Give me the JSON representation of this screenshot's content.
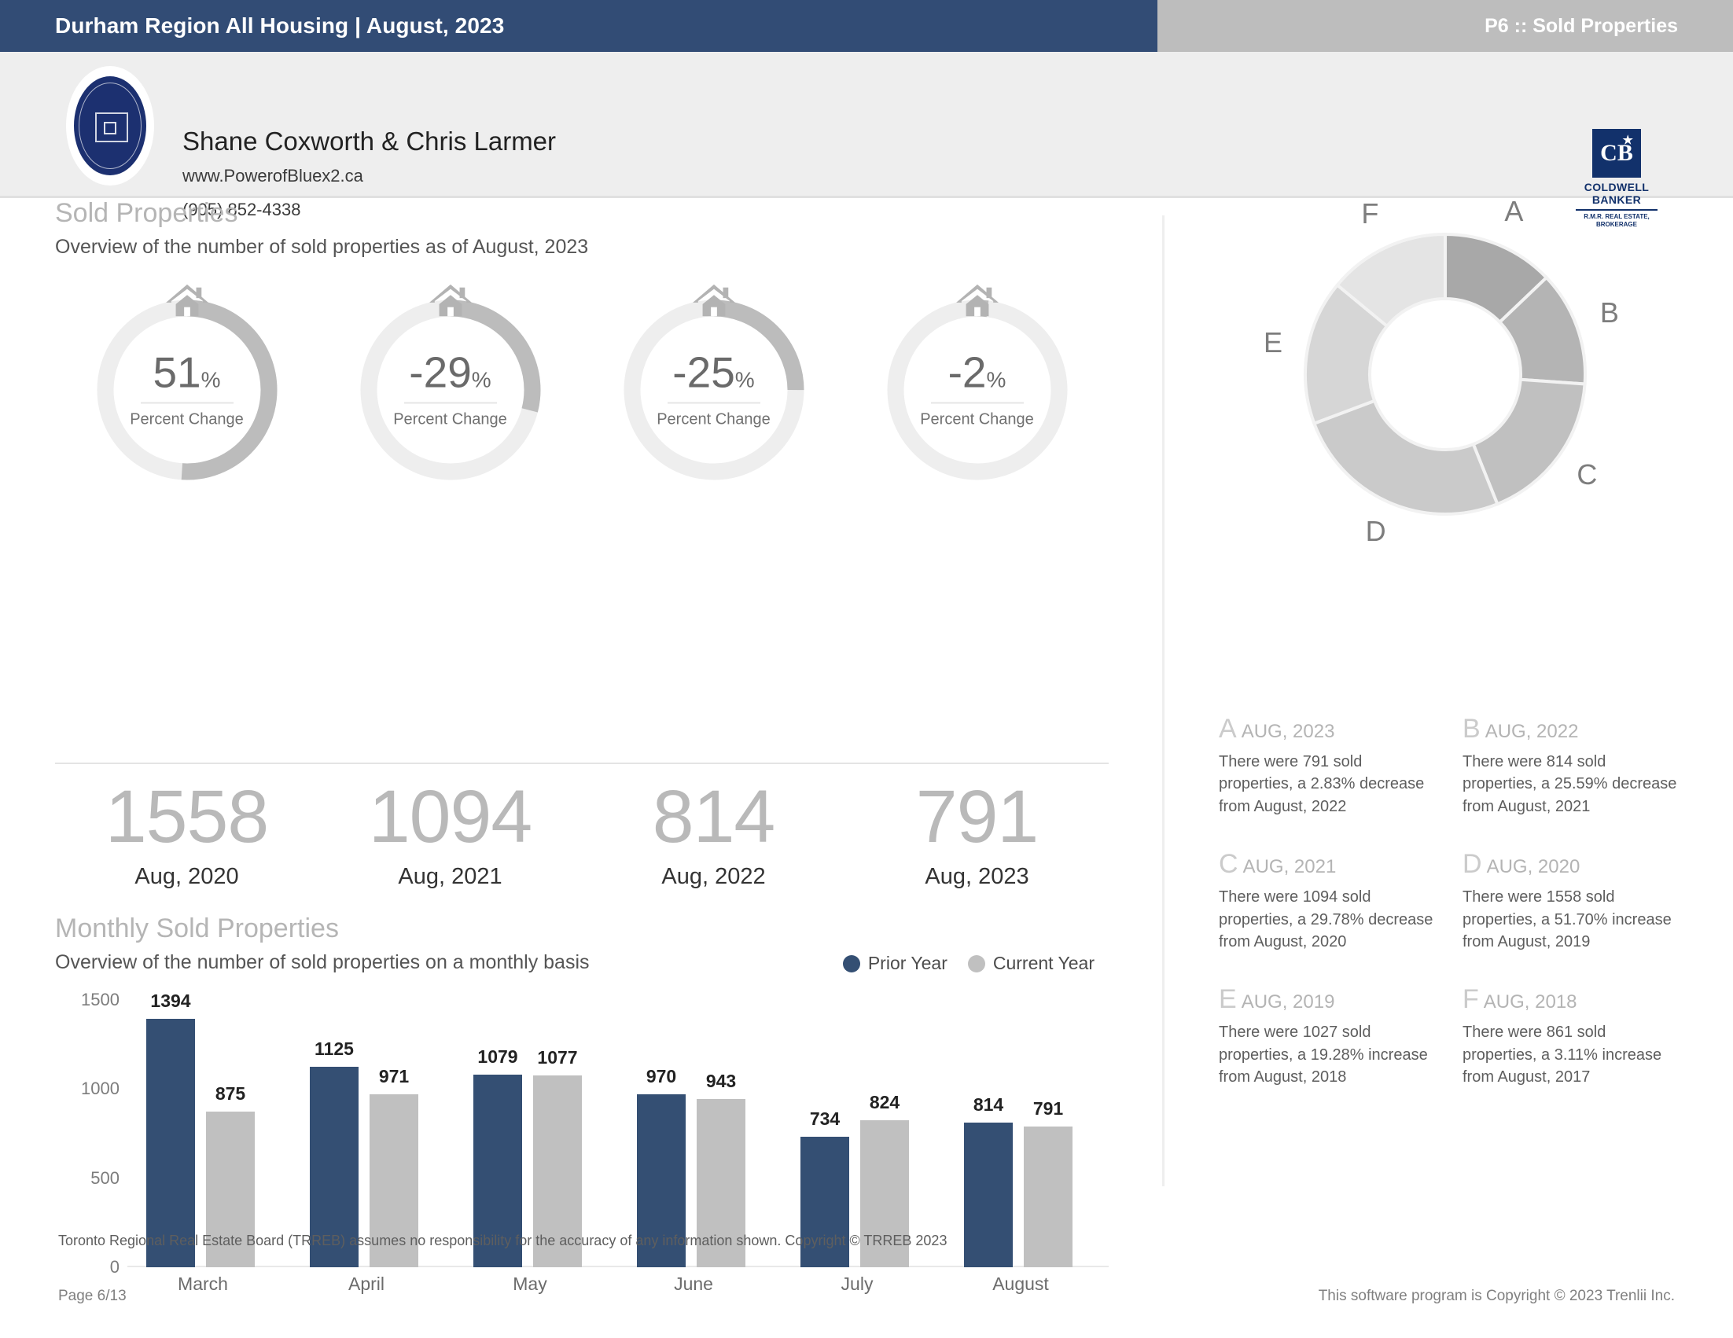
{
  "header": {
    "title": "Durham Region All Housing | August, 2023",
    "page_tag": "P6 :: Sold Properties"
  },
  "agent": {
    "name": "Shane Coxworth & Chris Larmer",
    "website": "www.PowerofBluex2.ca",
    "phone": "(905) 852-4338",
    "brokerage_name_line1": "COLDWELL",
    "brokerage_name_line2": "BANKER",
    "brokerage_sub_line1": "R.M.R. REAL ESTATE,",
    "brokerage_sub_line2": "BROKERAGE",
    "brokerage_mark": "CB"
  },
  "sold_section": {
    "title": "Sold Properties",
    "subtitle": "Overview of the number of sold properties as of August, 2023",
    "gauge_label": "Percent Change",
    "gauges": [
      {
        "percent_text": "51",
        "unit": "%",
        "fill": 51,
        "value": "1558",
        "year": "Aug, 2020"
      },
      {
        "percent_text": "-29",
        "unit": "%",
        "fill": 29,
        "value": "1094",
        "year": "Aug, 2021"
      },
      {
        "percent_text": "-25",
        "unit": "%",
        "fill": 25,
        "value": "814",
        "year": "Aug, 2022"
      },
      {
        "percent_text": "-2",
        "unit": "%",
        "fill": 2,
        "value": "791",
        "year": "Aug, 2023"
      }
    ]
  },
  "monthly_section": {
    "title": "Monthly Sold Properties",
    "subtitle": "Overview of the number of sold properties on a monthly basis",
    "legend": [
      {
        "label": "Prior Year",
        "color": "#344f73"
      },
      {
        "label": "Current Year",
        "color": "#c0c0c0"
      }
    ]
  },
  "chart_data": [
    {
      "type": "bar",
      "title": "Monthly Sold Properties",
      "xlabel": "",
      "ylabel": "",
      "ylim": [
        0,
        1500
      ],
      "yticks": [
        "0",
        "500",
        "1000",
        "1500"
      ],
      "grid": false,
      "legend_position": "top-right",
      "categories": [
        "March",
        "April",
        "May",
        "June",
        "July",
        "August"
      ],
      "series": [
        {
          "name": "Prior Year",
          "color": "#344f73",
          "values": [
            1394,
            1125,
            1079,
            970,
            734,
            814
          ]
        },
        {
          "name": "Current Year",
          "color": "#c0c0c0",
          "values": [
            875,
            971,
            1077,
            943,
            824,
            791
          ]
        }
      ]
    },
    {
      "type": "pie",
      "title": "",
      "labels": [
        "A",
        "B",
        "C",
        "D",
        "E",
        "F"
      ],
      "categories": [
        "AUG, 2023",
        "AUG, 2022",
        "AUG, 2021",
        "AUG, 2020",
        "AUG, 2019",
        "AUG, 2018"
      ],
      "values": [
        791,
        814,
        1094,
        1558,
        1027,
        861
      ],
      "colors": [
        "#a8a8a8",
        "#b4b4b4",
        "#c0c0c0",
        "#cacaca",
        "#d6d6d6",
        "#e4e4e4"
      ],
      "donut": true
    }
  ],
  "donut_labels": [
    {
      "letter": "A"
    },
    {
      "letter": "B"
    },
    {
      "letter": "C"
    },
    {
      "letter": "D"
    },
    {
      "letter": "E"
    },
    {
      "letter": "F"
    }
  ],
  "detail_cards": [
    {
      "letter": "A",
      "date": "AUG, 2023",
      "body": "There were 791 sold properties, a 2.83% decrease from August, 2022"
    },
    {
      "letter": "B",
      "date": "AUG, 2022",
      "body": "There were 814 sold properties, a 25.59% decrease from August, 2021"
    },
    {
      "letter": "C",
      "date": "AUG, 2021",
      "body": "There were 1094 sold properties, a 29.78% decrease from August, 2020"
    },
    {
      "letter": "D",
      "date": "AUG, 2020",
      "body": "There were 1558 sold properties, a 51.70% increase from August, 2019"
    },
    {
      "letter": "E",
      "date": "AUG, 2019",
      "body": "There were 1027 sold properties, a 19.28% increase from August, 2018"
    },
    {
      "letter": "F",
      "date": "AUG, 2018",
      "body": "There were 861 sold properties, a 3.11% increase from August, 2017"
    }
  ],
  "footer": {
    "disclaimer": "Toronto Regional Real Estate Board (TRREB) assumes no responsibility for the accuracy of any information shown. Copyright © TRREB 2023",
    "page": "Page 6/13",
    "copyright": "This software program is Copyright © 2023 Trenlii Inc."
  },
  "colors": {
    "header_navy": "#324c75",
    "header_gray": "#bdbdbd",
    "bar_prior": "#344f73",
    "bar_current": "#c0c0c0",
    "gauge_fill": "#bcbcbc",
    "gauge_track": "#eeeeee"
  }
}
